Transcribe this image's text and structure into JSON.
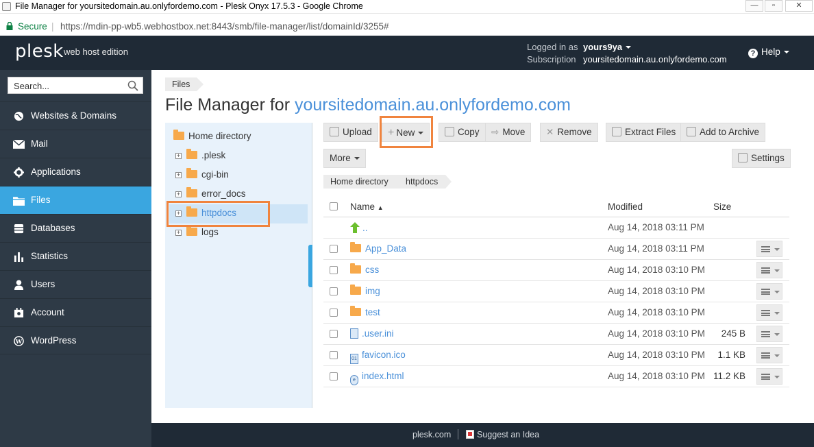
{
  "browser": {
    "window_title": "File Manager for yoursitedomain.au.onlyfordemo.com - Plesk Onyx 17.5.3 - Google Chrome",
    "secure_label": "Secure",
    "url": "https://mdin-pp-wb5.webhostbox.net:8443/smb/file-manager/list/domainId/3255#"
  },
  "header": {
    "logo": "plesk",
    "edition": "web host edition",
    "logged_in_label": "Logged in as",
    "user": "yours9ya",
    "subscription_label": "Subscription",
    "subscription": "yoursitedomain.au.onlyfordemo.com",
    "help_label": "Help"
  },
  "sidebar": {
    "search_placeholder": "Search...",
    "items": [
      {
        "label": "Websites & Domains",
        "icon": "globe-icon"
      },
      {
        "label": "Mail",
        "icon": "envelope-icon"
      },
      {
        "label": "Applications",
        "icon": "gear-icon"
      },
      {
        "label": "Files",
        "icon": "folder-icon",
        "active": true
      },
      {
        "label": "Databases",
        "icon": "database-icon"
      },
      {
        "label": "Statistics",
        "icon": "bar-chart-icon"
      },
      {
        "label": "Users",
        "icon": "user-icon"
      },
      {
        "label": "Account",
        "icon": "account-icon"
      },
      {
        "label": "WordPress",
        "icon": "wordpress-icon"
      }
    ]
  },
  "main": {
    "breadcrumb": "Files",
    "title_prefix": "File Manager for",
    "title_domain": "yoursitedomain.au.onlyfordemo.com",
    "tree": {
      "root": "Home directory",
      "nodes": [
        ".plesk",
        "cgi-bin",
        "error_docs",
        "httpdocs",
        "logs"
      ],
      "selected": "httpdocs"
    },
    "toolbar": {
      "upload": "Upload",
      "new": "New",
      "copy": "Copy",
      "move": "Move",
      "remove": "Remove",
      "extract": "Extract Files",
      "archive": "Add to Archive",
      "more": "More",
      "settings": "Settings"
    },
    "path": [
      "Home directory",
      "httpdocs"
    ],
    "table": {
      "col_name": "Name",
      "col_modified": "Modified",
      "col_size": "Size",
      "rows": [
        {
          "name": "..",
          "modified": "Aug 14, 2018 03:11 PM",
          "size": "",
          "type": "up"
        },
        {
          "name": "App_Data",
          "modified": "Aug 14, 2018 03:11 PM",
          "size": "",
          "type": "folder"
        },
        {
          "name": "css",
          "modified": "Aug 14, 2018 03:10 PM",
          "size": "",
          "type": "folder"
        },
        {
          "name": "img",
          "modified": "Aug 14, 2018 03:10 PM",
          "size": "",
          "type": "folder"
        },
        {
          "name": "test",
          "modified": "Aug 14, 2018 03:10 PM",
          "size": "",
          "type": "folder"
        },
        {
          "name": ".user.ini",
          "modified": "Aug 14, 2018 03:10 PM",
          "size": "245 B",
          "type": "file"
        },
        {
          "name": "favicon.ico",
          "modified": "Aug 14, 2018 03:10 PM",
          "size": "1.1 KB",
          "type": "binary"
        },
        {
          "name": "index.html",
          "modified": "Aug 14, 2018 03:10 PM",
          "size": "11.2 KB",
          "type": "html"
        }
      ]
    }
  },
  "footer": {
    "link1": "plesk.com",
    "link2": "Suggest an Idea"
  },
  "colors": {
    "header_bg": "#1f2a36",
    "sidebar_bg": "#2e3a46",
    "active_item": "#3aa6e0",
    "link": "#4a90d9",
    "highlight": "#f0843e",
    "folder": "#f7a94b"
  }
}
